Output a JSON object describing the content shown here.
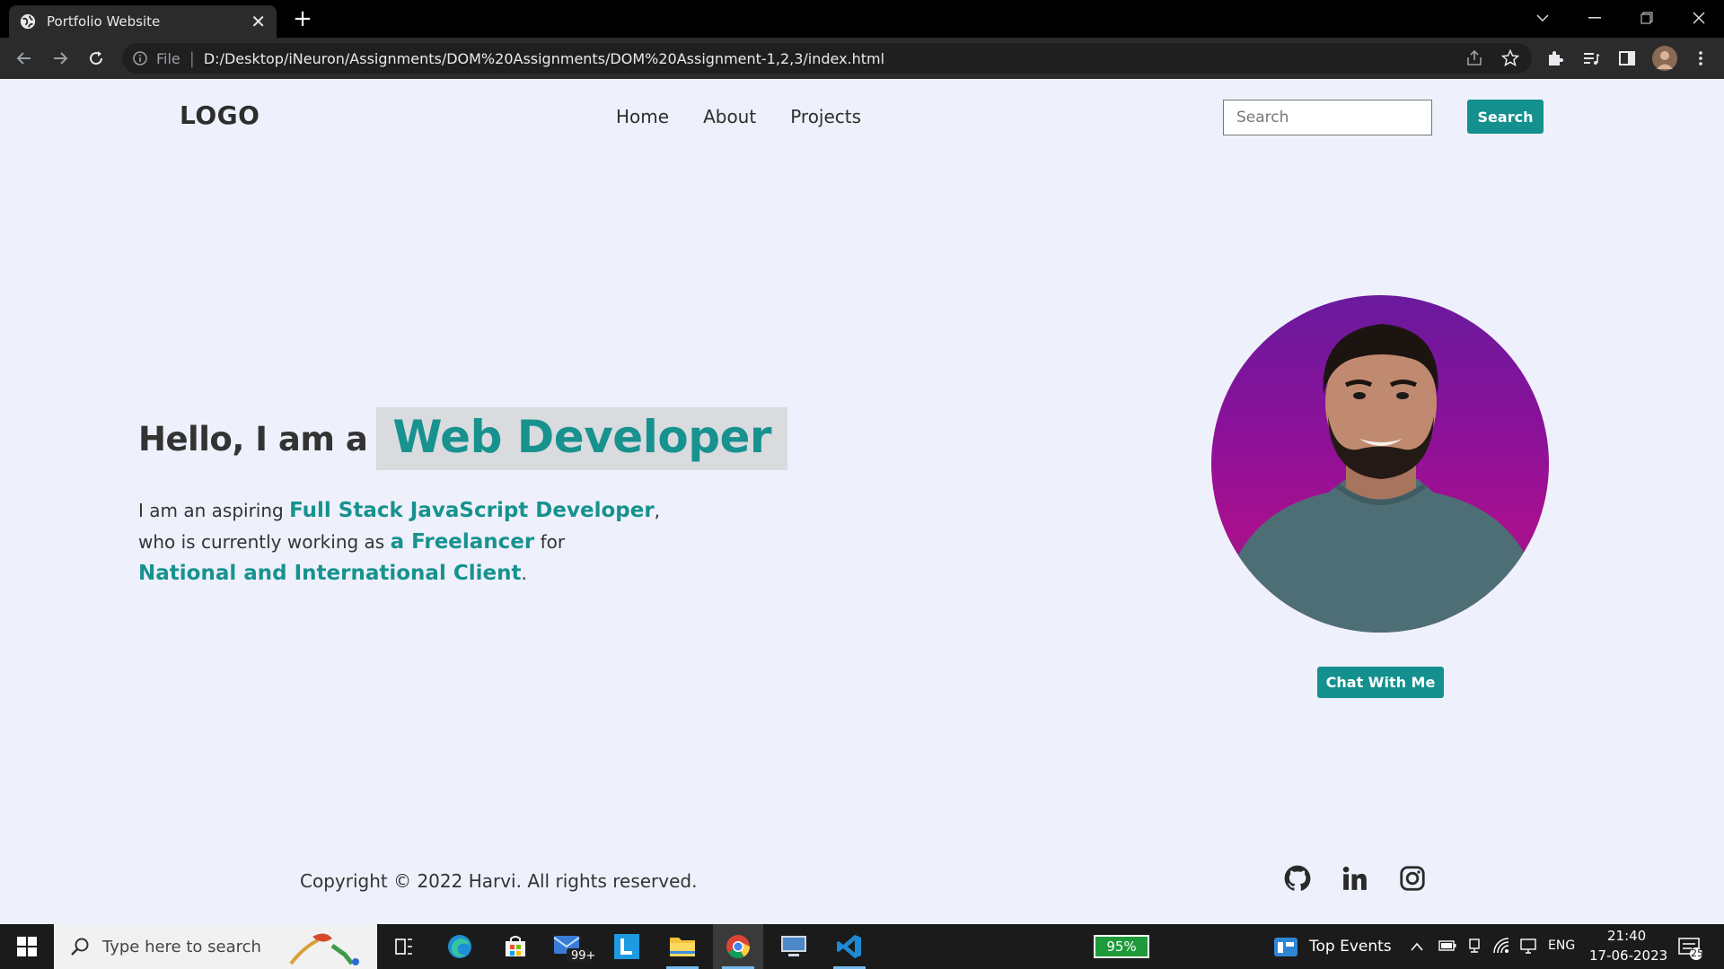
{
  "browser": {
    "tab_title": "Portfolio Website",
    "file_label": "File",
    "url": "D:/Desktop/iNeuron/Assignments/DOM%20Assignments/DOM%20Assignment-1,2,3/index.html"
  },
  "page": {
    "logo": "LOGO",
    "nav": [
      "Home",
      "About",
      "Projects"
    ],
    "search": {
      "placeholder": "Search",
      "button": "Search"
    },
    "hero": {
      "hello": "Hello, I am a",
      "role": "Web Developer",
      "desc_1": "I am an aspiring ",
      "desc_hl_1": "Full Stack JavaScript Developer",
      "desc_2": ",",
      "desc_3": "who is currently working as ",
      "desc_hl_2": "a Freelancer",
      "desc_4": " for",
      "desc_hl_3": "National and International Client",
      "desc_5": "."
    },
    "chat_button": "Chat With Me",
    "copyright": "Copyright © 2022 Harvi. All rights reserved.",
    "social": [
      "github-icon",
      "linkedin-icon",
      "instagram-icon"
    ]
  },
  "taskbar": {
    "search_placeholder": "Type here to search",
    "mail_badge": "99+",
    "battery": "95%",
    "widget_label": "Top Events",
    "language": "ENG",
    "time": "21:40",
    "date": "17-06-2023",
    "notifications": "25"
  },
  "colors": {
    "accent": "#14908e",
    "page_bg": "#eef1fb",
    "role_bg": "#d9dbdf"
  }
}
